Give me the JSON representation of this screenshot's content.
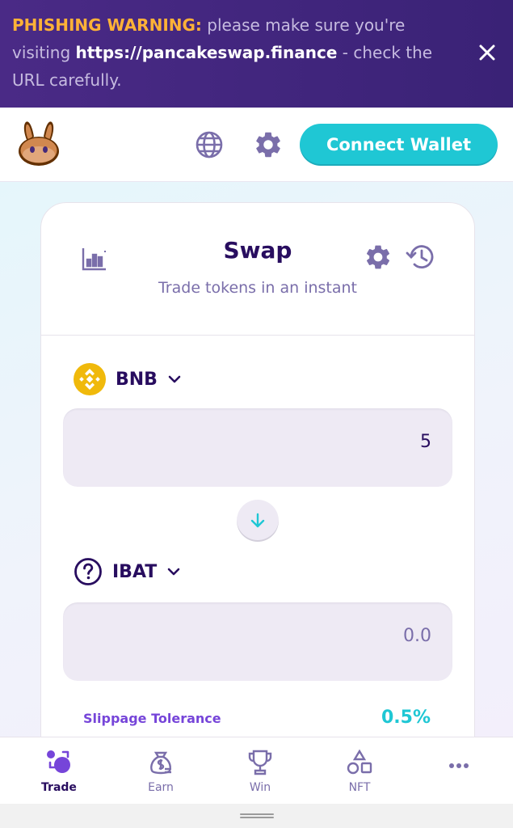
{
  "banner": {
    "warning_label": "PHISHING WARNING:",
    "message_part1": " please make sure you're visiting ",
    "url": "https://pancakeswap.finance",
    "message_part2": " - check the URL carefully."
  },
  "header": {
    "connect_label": "Connect Wallet"
  },
  "swap": {
    "title": "Swap",
    "subtitle": "Trade tokens in an instant",
    "from_token": "BNB",
    "from_amount": "5",
    "to_token": "IBAT",
    "to_amount": "0.0",
    "slippage_label": "Slippage Tolerance",
    "slippage_value": "0.5%"
  },
  "nav": {
    "items": [
      {
        "label": "Trade",
        "icon": "trade-icon",
        "active": true
      },
      {
        "label": "Earn",
        "icon": "earn-icon",
        "active": false
      },
      {
        "label": "Win",
        "icon": "trophy-icon",
        "active": false
      },
      {
        "label": "NFT",
        "icon": "nft-icon",
        "active": false
      },
      {
        "label": "",
        "icon": "more-icon",
        "active": false
      }
    ]
  },
  "colors": {
    "primary": "#1fc7d4",
    "text": "#280d5f",
    "text_subtle": "#7a6eaa",
    "secondary": "#7645d9",
    "warning": "#ffb237",
    "banner_bg": "#4a2a86"
  }
}
